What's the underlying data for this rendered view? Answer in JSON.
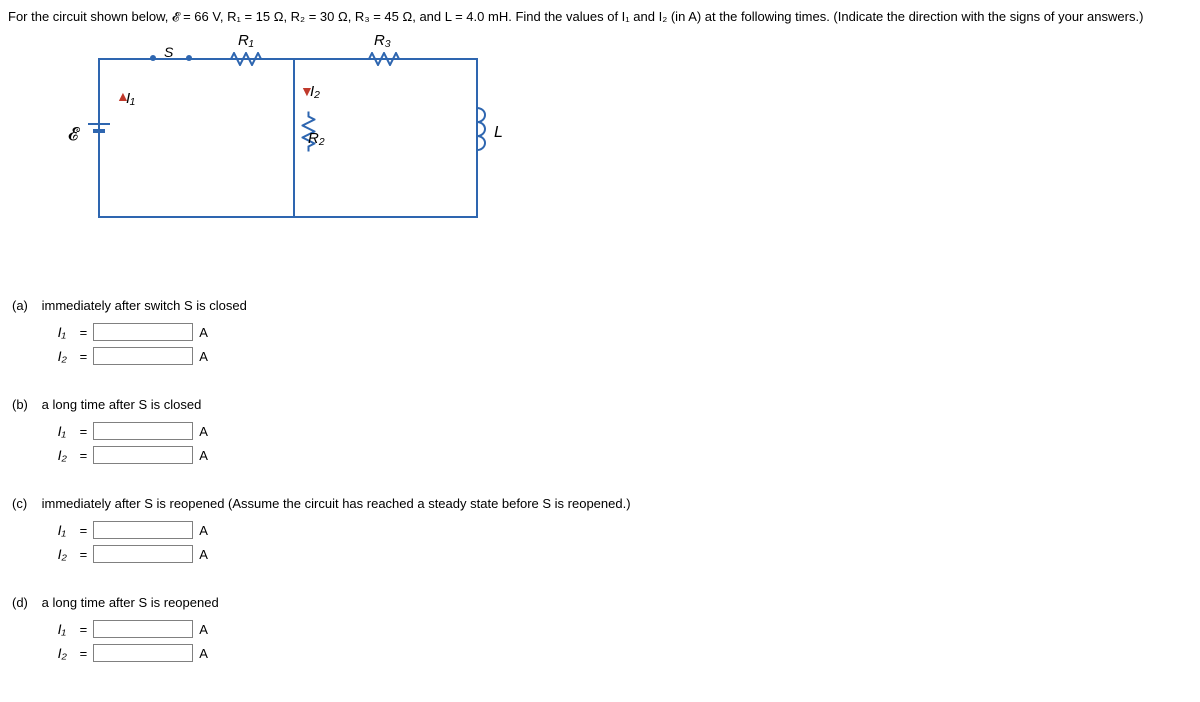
{
  "question": {
    "prefix": "For the circuit shown below, ",
    "values_text": "𝓔 = 66 V, R₁ = 15 Ω, R₂ = 30 Ω, R₃ = 45 Ω, and L = 4.0 mH.",
    "find_text": " Find the values of I₁ and I₂ (in A) at the following times. (Indicate the direction with the signs of your answers.)"
  },
  "circuit": {
    "s_label": "S",
    "r1_label": "R₁",
    "r2_label": "R₂",
    "r3_label": "R₃",
    "l_label": "L",
    "emf_label": "𝓔",
    "i1_label": "I₁",
    "i2_label": "I₂"
  },
  "parts": {
    "a": {
      "label": "(a)",
      "prompt": "immediately after switch S is closed",
      "i1_var": "I₁",
      "i2_var": "I₂"
    },
    "b": {
      "label": "(b)",
      "prompt": "a long time after S is closed",
      "i1_var": "I₁",
      "i2_var": "I₂"
    },
    "c": {
      "label": "(c)",
      "prompt": "immediately after S is reopened (Assume the circuit has reached a steady state before S is reopened.)",
      "i1_var": "I₁",
      "i2_var": "I₂"
    },
    "d": {
      "label": "(d)",
      "prompt": "a long time after S is reopened",
      "i1_var": "I₁",
      "i2_var": "I₂"
    }
  },
  "common": {
    "equals": "=",
    "unit": "A"
  }
}
